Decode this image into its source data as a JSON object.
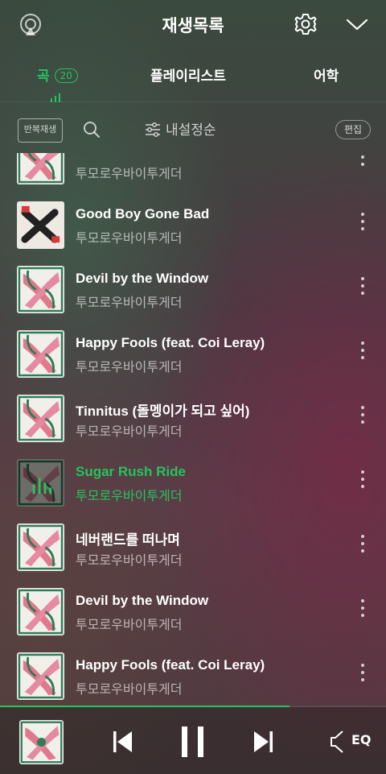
{
  "header": {
    "title": "재생목록"
  },
  "tabs": [
    {
      "label": "곡",
      "count": "20",
      "active": true
    },
    {
      "label": "플레이리스트"
    },
    {
      "label": "어학"
    }
  ],
  "toolbar": {
    "repeat_label": "반복재생",
    "sort_label": "내설정순",
    "edit_label": "편집"
  },
  "songs": [
    {
      "title": "",
      "artist": "투모로우바이투게더"
    },
    {
      "title": "Good Boy Gone Bad",
      "artist": "투모로우바이투게더"
    },
    {
      "title": "Devil by the Window",
      "artist": "투모로우바이투게더"
    },
    {
      "title": "Happy Fools (feat. Coi Leray)",
      "artist": "투모로우바이투게더"
    },
    {
      "title": "Tinnitus (돌멩이가 되고 싶어)",
      "artist": "투모로우바이투게더"
    },
    {
      "title": "Sugar Rush Ride",
      "artist": "투모로우바이투게더",
      "playing": true
    },
    {
      "title": "네버랜드를 떠나며",
      "artist": "투모로우바이투게더"
    },
    {
      "title": "Devil by the Window",
      "artist": "투모로우바이투게더"
    },
    {
      "title": "Happy Fools (feat. Coi Leray)",
      "artist": "투모로우바이투게더"
    }
  ],
  "player": {
    "eq_label": "EQ",
    "progress": 0.75
  },
  "colors": {
    "accent": "#22c55e"
  }
}
